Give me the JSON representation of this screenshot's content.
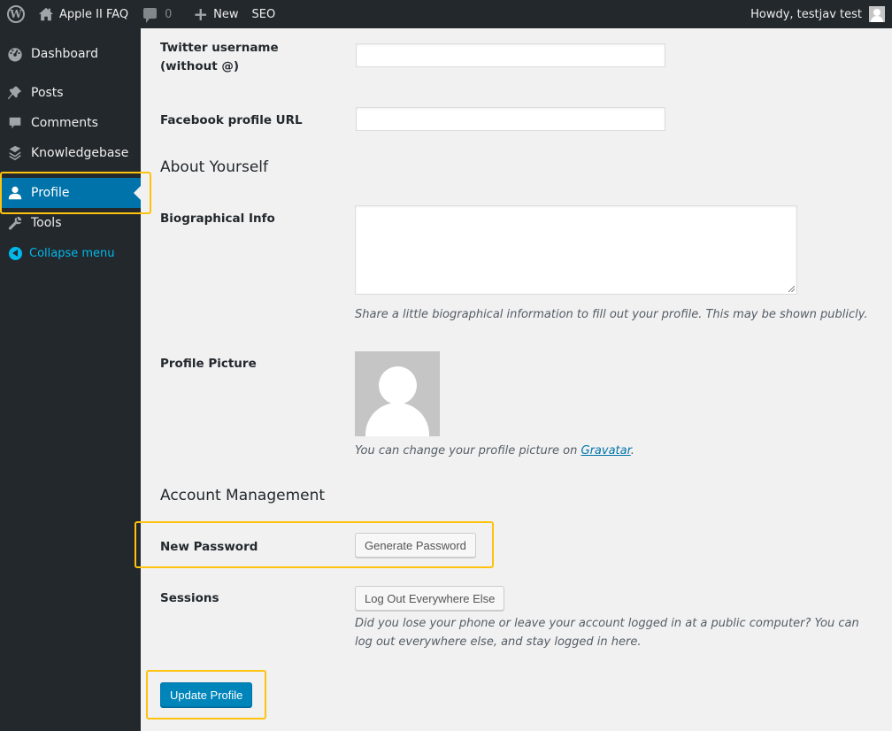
{
  "adminbar": {
    "site_name": "Apple II FAQ",
    "comments_count": "0",
    "new_label": "New",
    "seo_label": "SEO",
    "howdy": "Howdy, testjav test"
  },
  "sidebar": {
    "items": [
      {
        "label": "Dashboard",
        "icon": "dashboard-icon"
      },
      {
        "label": "Posts",
        "icon": "pin-icon"
      },
      {
        "label": "Comments",
        "icon": "comment-icon"
      },
      {
        "label": "Knowledgebase",
        "icon": "books-icon"
      },
      {
        "label": "Profile",
        "icon": "user-icon",
        "current": true
      },
      {
        "label": "Tools",
        "icon": "wrench-icon"
      }
    ],
    "collapse_label": "Collapse menu"
  },
  "form": {
    "twitter_label": "Twitter username (without @)",
    "twitter_value": "",
    "facebook_label": "Facebook profile URL",
    "facebook_value": "",
    "about_heading": "About Yourself",
    "bio_label": "Biographical Info",
    "bio_value": "",
    "bio_desc": "Share a little biographical information to fill out your profile. This may be shown publicly.",
    "picture_label": "Profile Picture",
    "picture_desc_prefix": "You can change your profile picture on ",
    "picture_desc_link": "Gravatar",
    "picture_desc_suffix": ".",
    "account_heading": "Account Management",
    "password_label": "New Password",
    "generate_password_button": "Generate Password",
    "sessions_label": "Sessions",
    "logout_button": "Log Out Everywhere Else",
    "sessions_desc": "Did you lose your phone or leave your account logged in at a public computer? You can log out everywhere else, and stay logged in here.",
    "update_button": "Update Profile"
  },
  "colors": {
    "accent": "#0073aa",
    "primary_button": "#0085ba",
    "highlight": "#ffc20e",
    "sidebar_bg": "#23282d"
  }
}
